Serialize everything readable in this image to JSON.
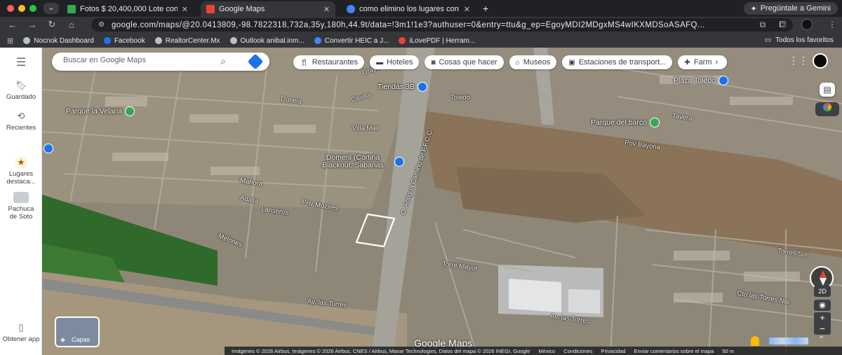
{
  "browser": {
    "window_dots": [
      "#ff5f57",
      "#febc2e",
      "#28c840"
    ],
    "tabs": [
      {
        "title": "Fotos $ 20,400,000 Lote con",
        "favicon_color": "#34a853",
        "active": false
      },
      {
        "title": "Google Maps",
        "favicon_color": "#ea4335",
        "active": true
      },
      {
        "title": "como elimino los lugares con",
        "favicon_color": "#4285f4",
        "active": false
      }
    ],
    "new_tab": "+",
    "gemini_label": "Pregúntale a Gemini",
    "url": "google.com/maps/@20.0413809,-98.7822318,732a,35y,180h,44.9t/data=!3m1!1e3?authuser=0&entry=ttu&g_ep=EgoyMDI2MDgxMS4wIKXMDSoASAFQ...",
    "bookmarks": [
      {
        "label": "Nocnok Dashboard",
        "color": "#bdc1c6"
      },
      {
        "label": "Facebook",
        "color": "#1877f2"
      },
      {
        "label": "RealtorCenter.Mx",
        "color": "#bdc1c6"
      },
      {
        "label": "Outlook anibal.inm...",
        "color": "#bdc1c6"
      },
      {
        "label": "Convertir HEIC a J...",
        "color": "#4285f4"
      },
      {
        "label": "iLovePDF | Herram...",
        "color": "#ea4335"
      }
    ],
    "all_bookmarks": "Todos los favoritos"
  },
  "sidebar": [
    {
      "label": "Guardado",
      "icon": "bookmark-icon"
    },
    {
      "label": "Recientes",
      "icon": "history-icon"
    },
    {
      "label": "Lugares destaca...",
      "icon": "star-icon"
    },
    {
      "label": "Pachuca de Soto",
      "icon": "place-thumbnail-icon"
    },
    {
      "label": "Obtener app",
      "icon": "phone-icon"
    }
  ],
  "search": {
    "placeholder": "Buscar en Google Maps"
  },
  "chips": [
    {
      "label": "Restaurantes",
      "icon": "restaurant-icon"
    },
    {
      "label": "Hoteles",
      "icon": "hotel-icon"
    },
    {
      "label": "Cosas que hacer",
      "icon": "camera-icon"
    },
    {
      "label": "Museos",
      "icon": "museum-icon"
    },
    {
      "label": "Estaciones de transport...",
      "icon": "transit-icon"
    },
    {
      "label": "Farm",
      "icon": "pharmacy-icon"
    }
  ],
  "pois": [
    {
      "label": "Tiendas 3B",
      "color": "#1a73e8"
    },
    {
      "label": "Parque la Velaria",
      "color": "#34a853"
    },
    {
      "label": "Plaza Toledo",
      "color": "#1a73e8"
    },
    {
      "label": "Parque del barco",
      "color": "#34a853"
    },
    {
      "label": "Domerii (Cortina Blackout, Sabanas",
      "color": "#1a73e8"
    }
  ],
  "streets": [
    "Graya",
    "Casilla",
    "Toledo",
    "Duneia",
    "Villa Miel",
    "Mahora",
    "Adalia",
    "Lanseros",
    "Priv Mozires",
    "Melones",
    "Av. las Torres",
    "Torre Mayor",
    "Tavera",
    "Priv Bayona",
    "Torres Sur",
    "Cto las Torres Nte",
    "C. Antigua Camino de F.F.C.C."
  ],
  "layers_label": "Capas",
  "controls": {
    "view_mode": "2D",
    "zoom_in": "+",
    "zoom_out": "−"
  },
  "footer": {
    "imagery": "Imágenes © 2026 Airbus, Imágenes © 2026 Airbus, CNES / Airbus, Maxar Technologies, Datos del mapa © 2026 INEGI, Google",
    "country": "México",
    "terms": "Condiciones",
    "privacy": "Privacidad",
    "feedback": "Enviar comentarios sobre el mapa",
    "scale": "50 m"
  },
  "logo": "Google Maps"
}
